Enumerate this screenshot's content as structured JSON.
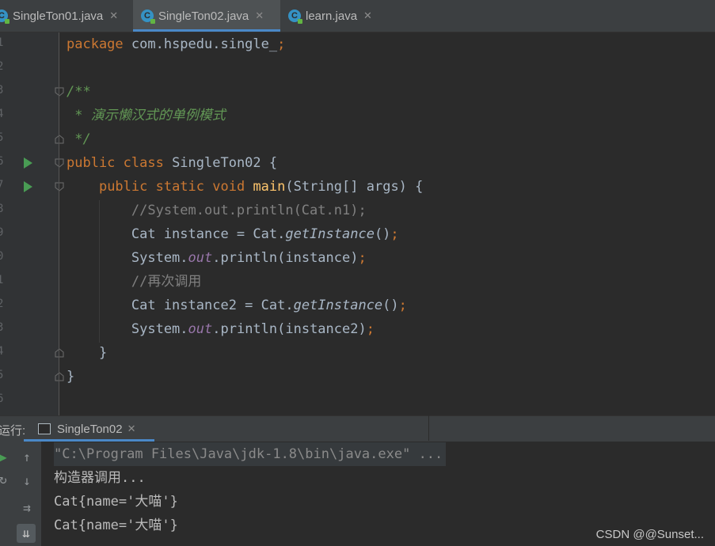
{
  "tabs": [
    {
      "label": "SingleTon01.java"
    },
    {
      "label": "SingleTon02.java",
      "active": true
    },
    {
      "label": "learn.java"
    }
  ],
  "line_numbers": [
    "1",
    "2",
    "3",
    "4",
    "5",
    "6",
    "7",
    "8",
    "9",
    "0",
    "1",
    "2",
    "3",
    "4",
    "5",
    "6"
  ],
  "code": {
    "l1": {
      "kw": "package",
      "rest": " com.hspedu.single_",
      "semi": ";"
    },
    "l3": "/**",
    "l4": " * 演示懒汉式的单例模式",
    "l5": " */",
    "l6": {
      "kw": "public class",
      "rest": " SingleTon02 {"
    },
    "l7": {
      "indent": "    ",
      "kw": "public static void",
      "sp": " ",
      "fn": "main",
      "rest": "(String[] args) {"
    },
    "l8": "        //System.out.println(Cat.n1);",
    "l9": {
      "a": "        Cat instance = Cat.",
      "it": "getInstance",
      "b": "()",
      "semi": ";"
    },
    "l10": {
      "a": "        System.",
      "st": "out",
      "b": ".println(instance)",
      "semi": ";"
    },
    "l11": "        //再次调用",
    "l12": {
      "a": "        Cat instance2 = Cat.",
      "it": "getInstance",
      "b": "()",
      "semi": ";"
    },
    "l13": {
      "a": "        System.",
      "st": "out",
      "b": ".println(instance2)",
      "semi": ";"
    },
    "l14": "    }",
    "l15": "}"
  },
  "run_panel": {
    "label": "运行:",
    "tab_label": "SingleTon02"
  },
  "console": {
    "lines": [
      "\"C:\\Program Files\\Java\\jdk-1.8\\bin\\java.exe\" ...",
      "构造器调用...",
      "Cat{name='大喵'}",
      "Cat{name='大喵'}"
    ]
  },
  "watermark": "CSDN @@Sunset...",
  "colors": {
    "keyword": "#cc7832",
    "comment": "#629755",
    "method": "#ffc66d",
    "static_field": "#9876aa",
    "accent": "#4a88c7"
  }
}
